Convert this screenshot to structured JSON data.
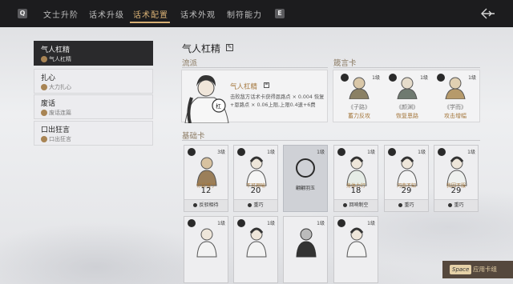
{
  "topbar": {
    "left_key": "Q",
    "right_key": "E",
    "tabs": [
      "文士升阶",
      "话术升级",
      "话术配置",
      "话术外观",
      "制符能力"
    ],
    "active_tab": 2
  },
  "loadouts": [
    {
      "name": "气人杠精",
      "sub": "气人杠精",
      "active": true
    },
    {
      "name": "扎心",
      "sub": "大力扎心",
      "active": false
    },
    {
      "name": "废话",
      "sub": "废话连篇",
      "active": false
    },
    {
      "name": "口出狂言",
      "sub": "口出狂言",
      "active": false
    }
  ],
  "header": {
    "title": "气人杠精"
  },
  "school": {
    "section_label": "流派",
    "name": "气人杠精",
    "description": "击败敌方话术卡获得恩路点 × 0.004 恢复+恩路点 × 0.06上限,上限0.4速+6费",
    "portrait_tag": "杠"
  },
  "maxims": {
    "section_label": "箴言卡",
    "cards": [
      {
        "level": "1级",
        "title": "《子路》",
        "effect": "蓄力反攻"
      },
      {
        "level": "1级",
        "title": "《颜渊》",
        "effect": "恢复恩路"
      },
      {
        "level": "1级",
        "title": "《学而》",
        "effect": "攻击增幅"
      }
    ]
  },
  "deck": {
    "section_label": "基础卡",
    "cards": [
      {
        "level": "3级",
        "name": "你最懂了",
        "value": "12",
        "tag": "反驳相待"
      },
      {
        "level": "1级",
        "name": "不可理喻",
        "value": "20",
        "tag": "重巧"
      },
      {
        "level": "1级",
        "name": "翩翩羽玉",
        "value": "",
        "tag": ""
      },
      {
        "level": "1级",
        "name": "身体力行",
        "value": "18",
        "tag": "回响制空"
      },
      {
        "level": "1级",
        "name": "河南不知",
        "value": "29",
        "tag": "重巧"
      },
      {
        "level": "1级",
        "name": "我因不服",
        "value": "29",
        "tag": "重巧"
      },
      {
        "level": "1级",
        "name": "",
        "value": "",
        "tag": ""
      },
      {
        "level": "1级",
        "name": "",
        "value": "",
        "tag": ""
      },
      {
        "level": "1级",
        "name": "",
        "value": "",
        "tag": ""
      },
      {
        "level": "1级",
        "name": "",
        "value": "",
        "tag": ""
      }
    ]
  },
  "hint": {
    "key": "Space",
    "label": "应用卡组"
  },
  "colors": {
    "accent": "#d8b074",
    "topbar": "#1c1c1e",
    "card_name": "#a5783e"
  }
}
